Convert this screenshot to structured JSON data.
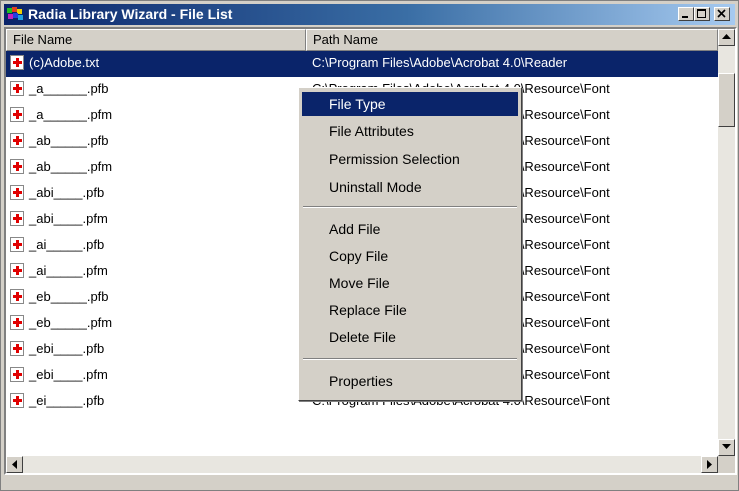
{
  "window": {
    "title": "Radia Library Wizard - File List"
  },
  "columns": {
    "name": "File Name",
    "path": "Path Name"
  },
  "rows": [
    {
      "name": "(c)Adobe.txt",
      "path": "C:\\Program Files\\Adobe\\Acrobat 4.0\\Reader",
      "selected": true
    },
    {
      "name": "_a______.pfb",
      "path": "C:\\Program Files\\Adobe\\Acrobat 4.0\\Resource\\Font"
    },
    {
      "name": "_a______.pfm",
      "path": "C:\\Program Files\\Adobe\\Acrobat 4.0\\Resource\\Font"
    },
    {
      "name": "_ab_____.pfb",
      "path": "C:\\Program Files\\Adobe\\Acrobat 4.0\\Resource\\Font"
    },
    {
      "name": "_ab_____.pfm",
      "path": "C:\\Program Files\\Adobe\\Acrobat 4.0\\Resource\\Font"
    },
    {
      "name": "_abi____.pfb",
      "path": "C:\\Program Files\\Adobe\\Acrobat 4.0\\Resource\\Font"
    },
    {
      "name": "_abi____.pfm",
      "path": "C:\\Program Files\\Adobe\\Acrobat 4.0\\Resource\\Font"
    },
    {
      "name": "_ai_____.pfb",
      "path": "C:\\Program Files\\Adobe\\Acrobat 4.0\\Resource\\Font"
    },
    {
      "name": "_ai_____.pfm",
      "path": "C:\\Program Files\\Adobe\\Acrobat 4.0\\Resource\\Font"
    },
    {
      "name": "_eb_____.pfb",
      "path": "C:\\Program Files\\Adobe\\Acrobat 4.0\\Resource\\Font"
    },
    {
      "name": "_eb_____.pfm",
      "path": "C:\\Program Files\\Adobe\\Acrobat 4.0\\Resource\\Font"
    },
    {
      "name": "_ebi____.pfb",
      "path": "C:\\Program Files\\Adobe\\Acrobat 4.0\\Resource\\Font"
    },
    {
      "name": "_ebi____.pfm",
      "path": "C:\\Program Files\\Adobe\\Acrobat 4.0\\Resource\\Font"
    },
    {
      "name": "_ei_____.pfb",
      "path": "C:\\Program Files\\Adobe\\Acrobat 4.0\\Resource\\Font"
    }
  ],
  "context_menu": {
    "file_type": "File Type",
    "file_attributes": "File Attributes",
    "permission_selection": "Permission Selection",
    "uninstall_mode": "Uninstall Mode",
    "add_file": "Add File",
    "copy_file": "Copy File",
    "move_file": "Move File",
    "replace_file": "Replace File",
    "delete_file": "Delete File",
    "properties": "Properties"
  },
  "colors": {
    "selection": "#0a246a",
    "face": "#d4d0c8",
    "file_icon_cross": "#e00000"
  }
}
